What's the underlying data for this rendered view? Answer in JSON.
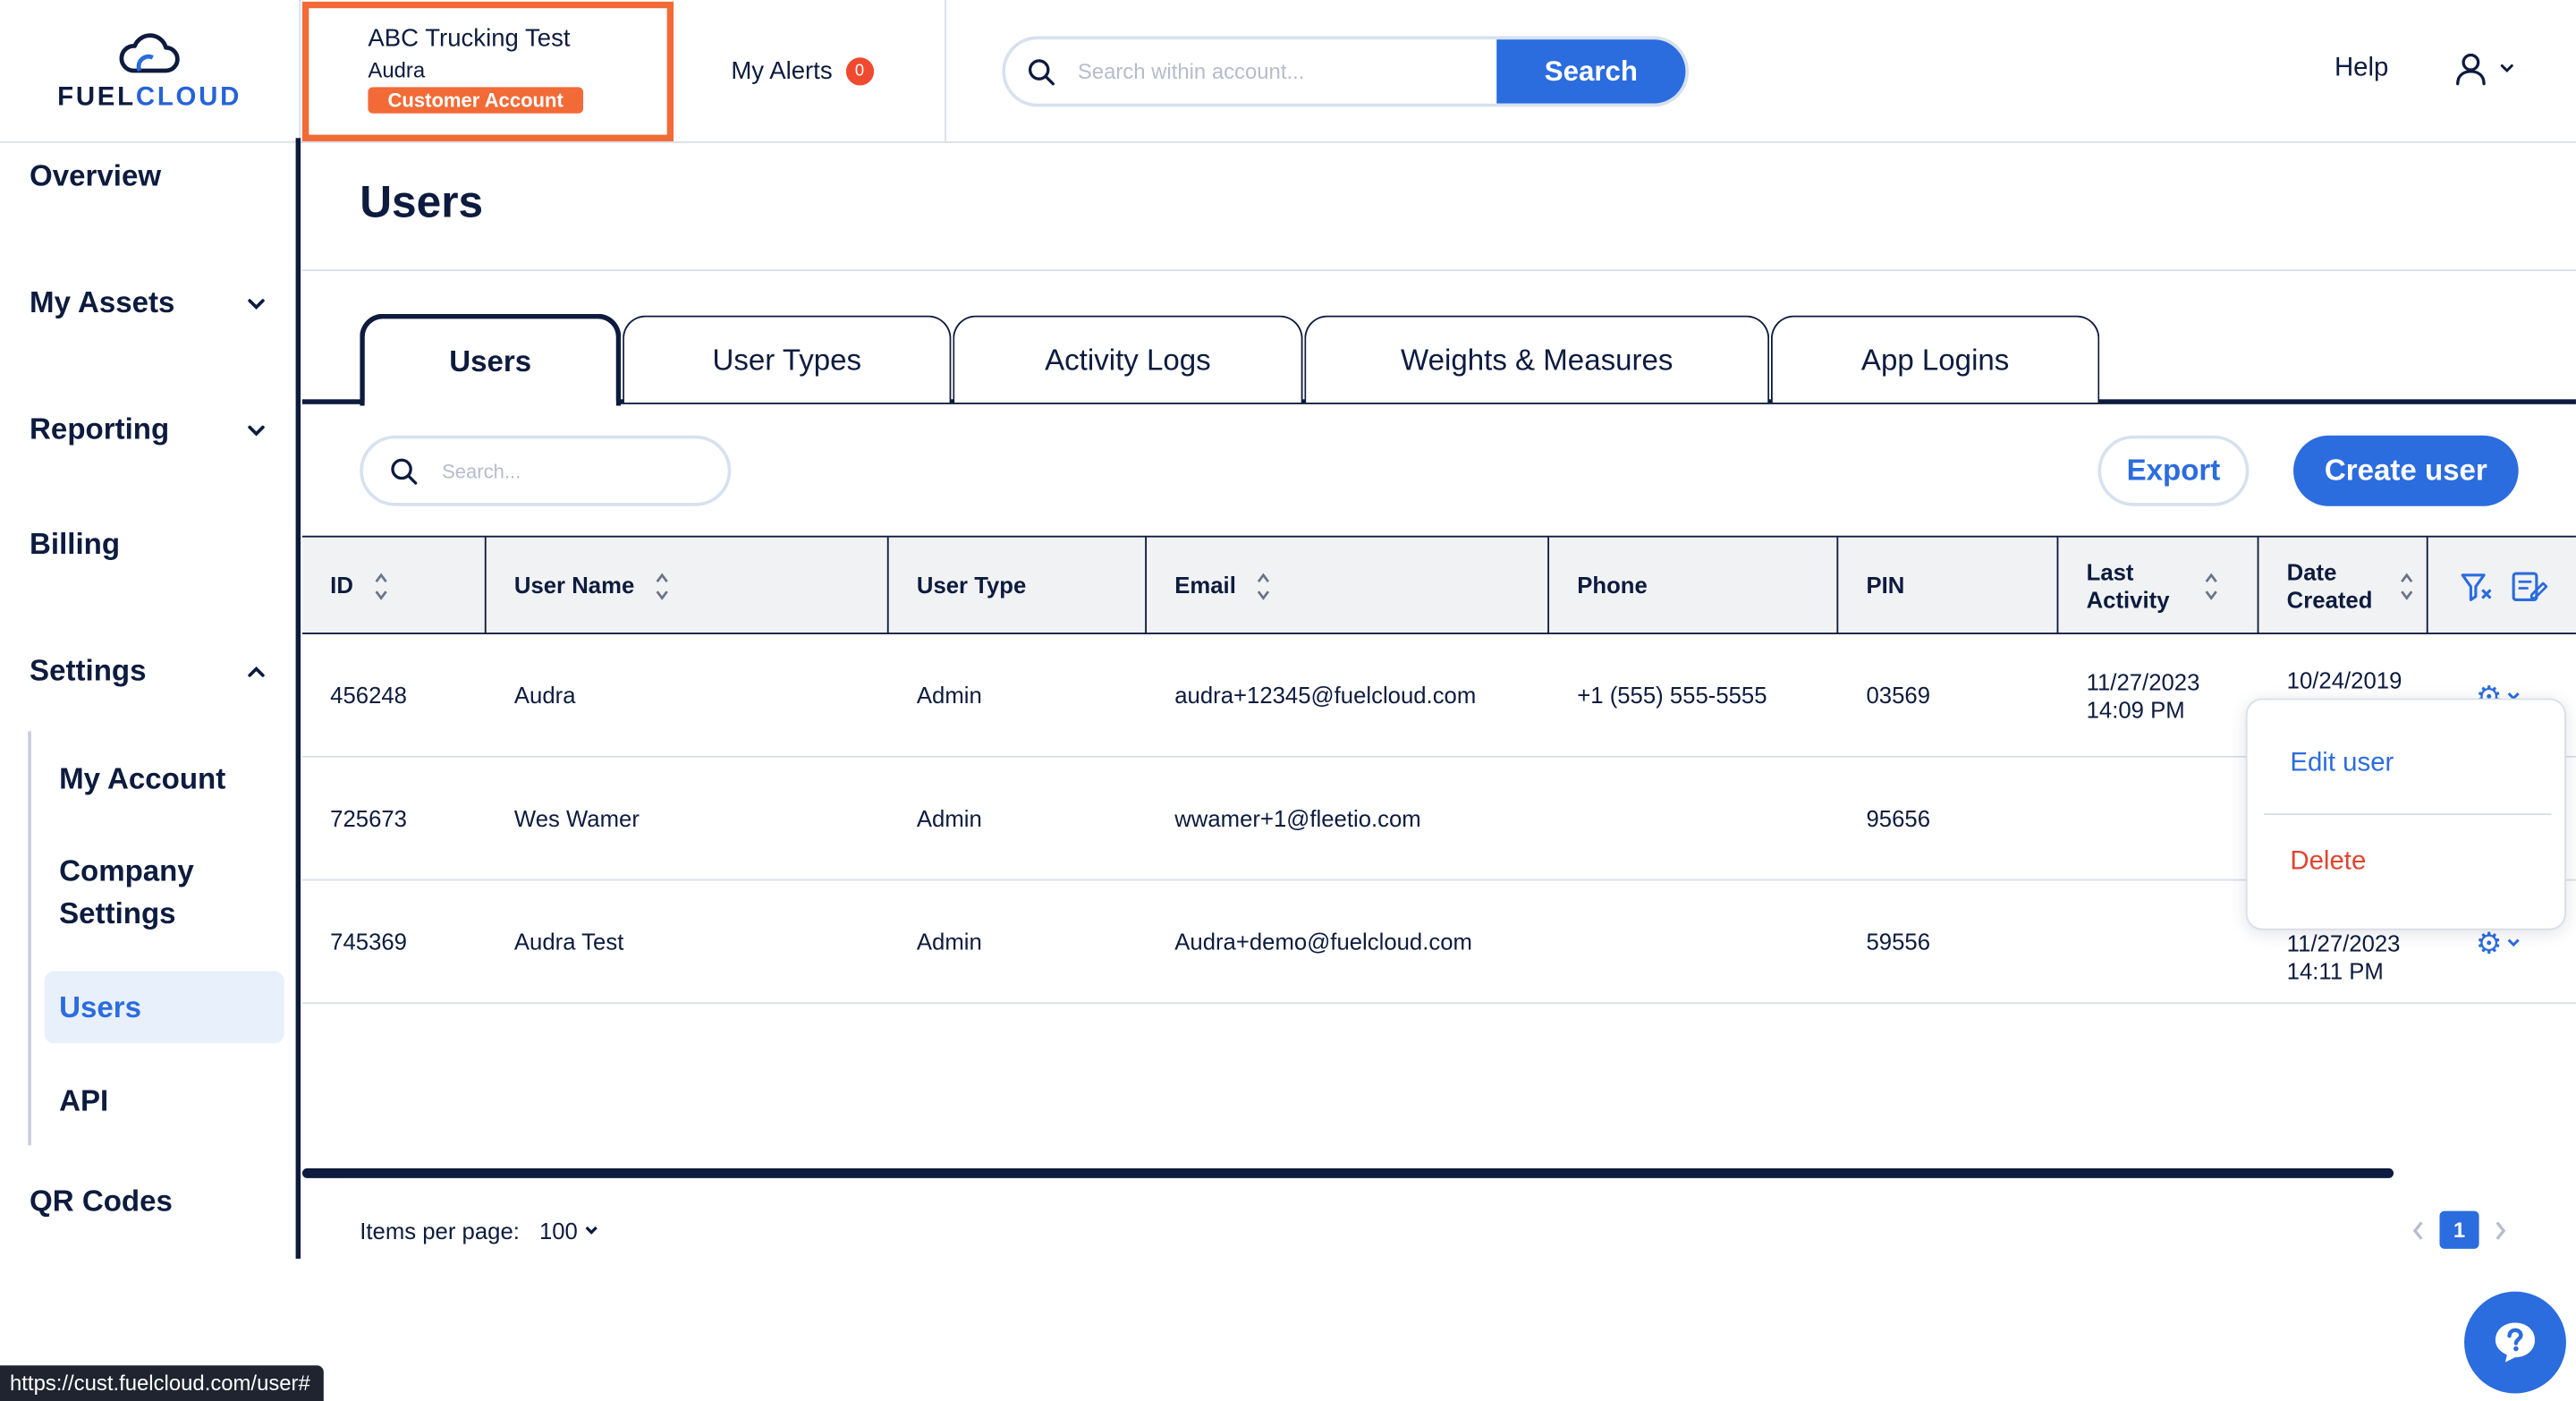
{
  "brand": {
    "logo_prefix": "FUEL",
    "logo_suffix": "CLOUD"
  },
  "account": {
    "name": "ABC Trucking Test",
    "user": "Audra",
    "badge": "Customer Account"
  },
  "alerts": {
    "label": "My Alerts",
    "count": "0"
  },
  "global_search": {
    "placeholder": "Search within account...",
    "button": "Search"
  },
  "header": {
    "help": "Help"
  },
  "sidebar": {
    "overview": "Overview",
    "my_assets": "My Assets",
    "reporting": "Reporting",
    "billing": "Billing",
    "settings": "Settings",
    "sub": {
      "my_account": "My Account",
      "company_settings_1": "Company",
      "company_settings_2": "Settings",
      "users": "Users",
      "api": "API"
    },
    "qr_codes": "QR Codes"
  },
  "page": {
    "title": "Users"
  },
  "tabs": [
    "Users",
    "User Types",
    "Activity Logs",
    "Weights & Measures",
    "App Logins"
  ],
  "toolbar": {
    "search_placeholder": "Search...",
    "export": "Export",
    "create": "Create user"
  },
  "table": {
    "headers": {
      "id": "ID",
      "user_name": "User Name",
      "user_type": "User Type",
      "email": "Email",
      "phone": "Phone",
      "pin": "PIN",
      "last_activity_1": "Last",
      "last_activity_2": "Activity",
      "date_created_1": "Date",
      "date_created_2": "Created"
    },
    "rows": [
      {
        "id": "456248",
        "name": "Audra",
        "type": "Admin",
        "email": "audra+12345@fuelcloud.com",
        "phone": "+1 (555) 555-5555",
        "pin": "03569",
        "last_date": "11/27/2023",
        "last_time": "14:09 PM",
        "created_date": "10/24/2019",
        "created_time": ""
      },
      {
        "id": "725673",
        "name": "Wes Wamer",
        "type": "Admin",
        "email": "wwamer+1@fleetio.com",
        "phone": "",
        "pin": "95656",
        "last_date": "",
        "last_time": "",
        "created_date": "",
        "created_time": ""
      },
      {
        "id": "745369",
        "name": "Audra Test",
        "type": "Admin",
        "email": "Audra+demo@fuelcloud.com",
        "phone": "",
        "pin": "59556",
        "last_date": "",
        "last_time": "",
        "created_date": "11/27/2023",
        "created_time": "14:11 PM"
      }
    ]
  },
  "row_menu": {
    "edit": "Edit user",
    "delete": "Delete"
  },
  "footer": {
    "items_per_page": "Items per page:",
    "per_page_value": "100",
    "current_page": "1"
  },
  "status_bar": {
    "url": "https://cust.fuelcloud.com/user#"
  },
  "colors": {
    "primary": "#2b6cde",
    "navy": "#0d1b3e",
    "accent_orange": "#f26a35",
    "danger": "#e0452f"
  }
}
